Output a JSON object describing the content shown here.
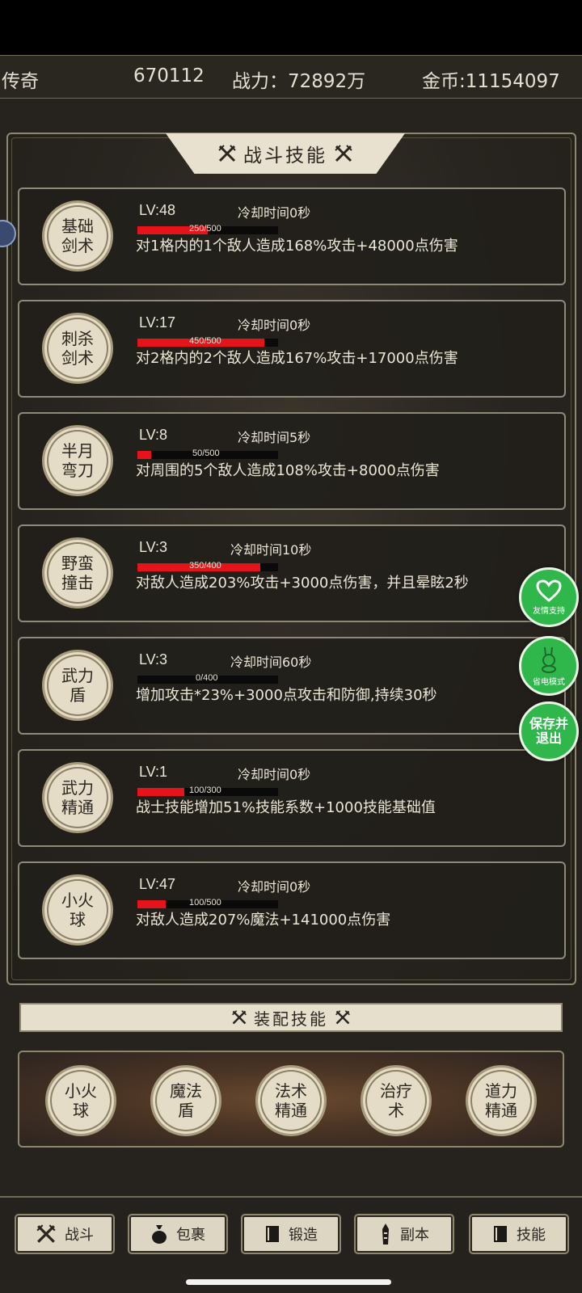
{
  "topbar": {
    "name": "传奇",
    "id": "670112",
    "power": "战力：72892万",
    "gold": "金币:11154097"
  },
  "title": "战斗技能",
  "skills": [
    {
      "icon": "基础剑术",
      "lv": "LV:48",
      "cd": "冷却时间0秒",
      "progress": "250/500",
      "progress_frac": 0.5,
      "desc": "对1格内的1个敌人造成168%攻击+48000点伤害"
    },
    {
      "icon": "刺杀剑术",
      "lv": "LV:17",
      "cd": "冷却时间0秒",
      "progress": "450/500",
      "progress_frac": 0.9,
      "desc": "对2格内的2个敌人造成167%攻击+17000点伤害"
    },
    {
      "icon": "半月弯刀",
      "lv": "LV:8",
      "cd": "冷却时间5秒",
      "progress": "50/500",
      "progress_frac": 0.1,
      "desc": "对周围的5个敌人造成108%攻击+8000点伤害"
    },
    {
      "icon": "野蛮撞击",
      "lv": "LV:3",
      "cd": "冷却时间10秒",
      "progress": "350/400",
      "progress_frac": 0.875,
      "desc": "对敌人造成203%攻击+3000点伤害，并且晕眩2秒"
    },
    {
      "icon": "武力盾",
      "lv": "LV:3",
      "cd": "冷却时间60秒",
      "progress": "0/400",
      "progress_frac": 0,
      "desc": "增加攻击*23%+3000点攻击和防御,持续30秒"
    },
    {
      "icon": "武力精通",
      "lv": "LV:1",
      "cd": "冷却时间0秒",
      "progress": "100/300",
      "progress_frac": 0.333,
      "desc": "战士技能增加51%技能系数+1000技能基础值"
    },
    {
      "icon": "小火球",
      "lv": "LV:47",
      "cd": "冷却时间0秒",
      "progress": "100/500",
      "progress_frac": 0.2,
      "desc": "对敌人造成207%魔法+141000点伤害"
    }
  ],
  "float_buttons": {
    "support": "友情支持",
    "power_save": "省电模式",
    "save_exit": "保存并退出"
  },
  "equip_title": "装配技能",
  "equipped": [
    "小火球",
    "魔法盾",
    "法术精通",
    "治疗术",
    "道力精通"
  ],
  "nav": [
    "战斗",
    "包裹",
    "锻造",
    "副本",
    "技能"
  ],
  "colors": {
    "bar_fill": "#e5141b",
    "float_green": "#2fb74c"
  }
}
